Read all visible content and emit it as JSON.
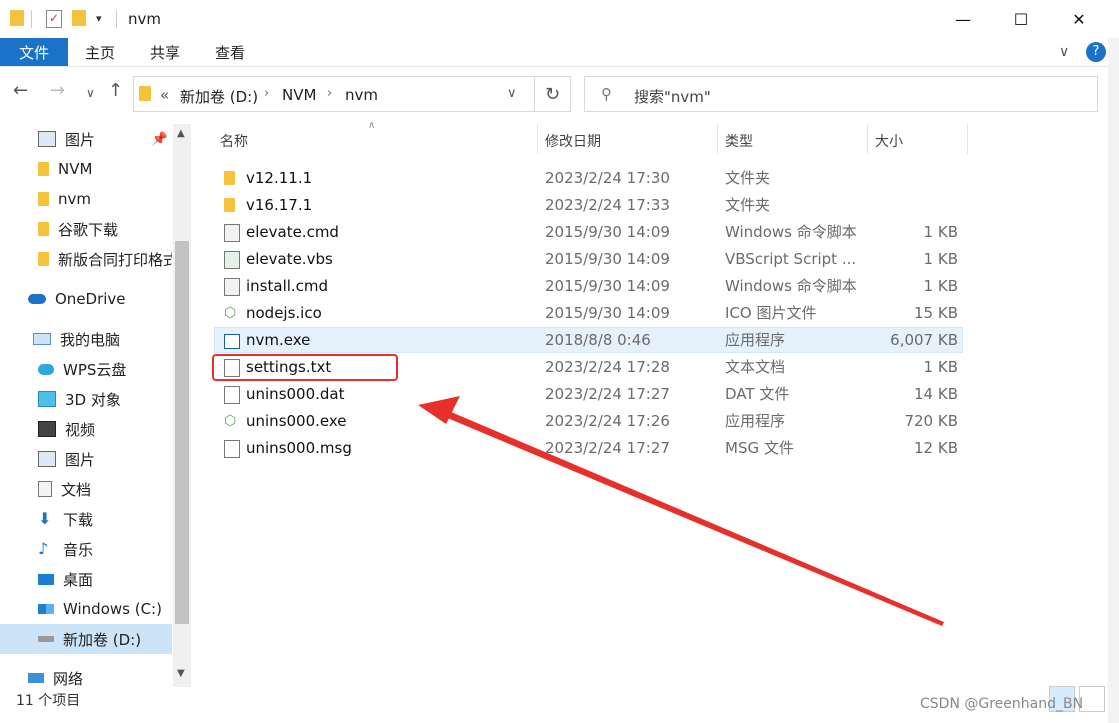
{
  "window": {
    "title": "nvm",
    "minimize": "—",
    "maximize": "☐",
    "close": "✕"
  },
  "ribbon": {
    "tabs": [
      "文件",
      "主页",
      "共享",
      "查看"
    ],
    "help": "?",
    "expand": "∨"
  },
  "address": {
    "path_prefix": "«",
    "segments": [
      "新加卷 (D:)",
      "NVM",
      "nvm"
    ],
    "search_placeholder": "搜索\"nvm\""
  },
  "sidebar": {
    "items": [
      {
        "label": "图片",
        "icon": "pictures-icon",
        "pinned": true
      },
      {
        "label": "NVM",
        "icon": "folder-icon"
      },
      {
        "label": "nvm",
        "icon": "folder-icon"
      },
      {
        "label": "谷歌下载",
        "icon": "folder-icon"
      },
      {
        "label": "新版合同打印格式",
        "icon": "folder-icon"
      },
      {
        "label": "OneDrive",
        "icon": "onedrive-icon"
      },
      {
        "label": "我的电脑",
        "icon": "computer-icon"
      },
      {
        "label": "WPS云盘",
        "icon": "wps-cloud-icon"
      },
      {
        "label": "3D 对象",
        "icon": "3d-objects-icon"
      },
      {
        "label": "视频",
        "icon": "videos-icon"
      },
      {
        "label": "图片",
        "icon": "pictures-icon"
      },
      {
        "label": "文档",
        "icon": "documents-icon"
      },
      {
        "label": "下载",
        "icon": "downloads-icon"
      },
      {
        "label": "音乐",
        "icon": "music-icon"
      },
      {
        "label": "桌面",
        "icon": "desktop-icon"
      },
      {
        "label": "Windows (C:)",
        "icon": "drive-c-icon"
      },
      {
        "label": "新加卷 (D:)",
        "icon": "drive-d-icon",
        "selected": true
      },
      {
        "label": "网络",
        "icon": "network-icon"
      }
    ]
  },
  "columns": [
    "名称",
    "修改日期",
    "类型",
    "大小"
  ],
  "files": [
    {
      "name": "v12.11.1",
      "date": "2023/2/24 17:30",
      "type": "文件夹",
      "size": "",
      "icon": "folder-icon"
    },
    {
      "name": "v16.17.1",
      "date": "2023/2/24 17:33",
      "type": "文件夹",
      "size": "",
      "icon": "folder-icon"
    },
    {
      "name": "elevate.cmd",
      "date": "2015/9/30 14:09",
      "type": "Windows 命令脚本",
      "size": "1 KB",
      "icon": "cmd-file-icon"
    },
    {
      "name": "elevate.vbs",
      "date": "2015/9/30 14:09",
      "type": "VBScript Script ...",
      "size": "1 KB",
      "icon": "vbs-file-icon"
    },
    {
      "name": "install.cmd",
      "date": "2015/9/30 14:09",
      "type": "Windows 命令脚本",
      "size": "1 KB",
      "icon": "cmd-file-icon"
    },
    {
      "name": "nodejs.ico",
      "date": "2015/9/30 14:09",
      "type": "ICO 图片文件",
      "size": "15 KB",
      "icon": "ico-file-icon"
    },
    {
      "name": "nvm.exe",
      "date": "2018/8/8 0:46",
      "type": "应用程序",
      "size": "6,007 KB",
      "icon": "exe-file-icon",
      "selected": true
    },
    {
      "name": "settings.txt",
      "date": "2023/2/24 17:28",
      "type": "文本文档",
      "size": "1 KB",
      "icon": "txt-file-icon",
      "highlighted": true
    },
    {
      "name": "unins000.dat",
      "date": "2023/2/24 17:27",
      "type": "DAT 文件",
      "size": "14 KB",
      "icon": "dat-file-icon"
    },
    {
      "name": "unins000.exe",
      "date": "2023/2/24 17:26",
      "type": "应用程序",
      "size": "720 KB",
      "icon": "setup-exe-icon"
    },
    {
      "name": "unins000.msg",
      "date": "2023/2/24 17:27",
      "type": "MSG 文件",
      "size": "12 KB",
      "icon": "msg-file-icon"
    }
  ],
  "status": {
    "count": "11 个项目"
  },
  "watermark": "CSDN @Greenhand_BN",
  "colors": {
    "accent": "#1a73c9",
    "selection": "#cce4f7",
    "annotation": "#e8302a"
  }
}
